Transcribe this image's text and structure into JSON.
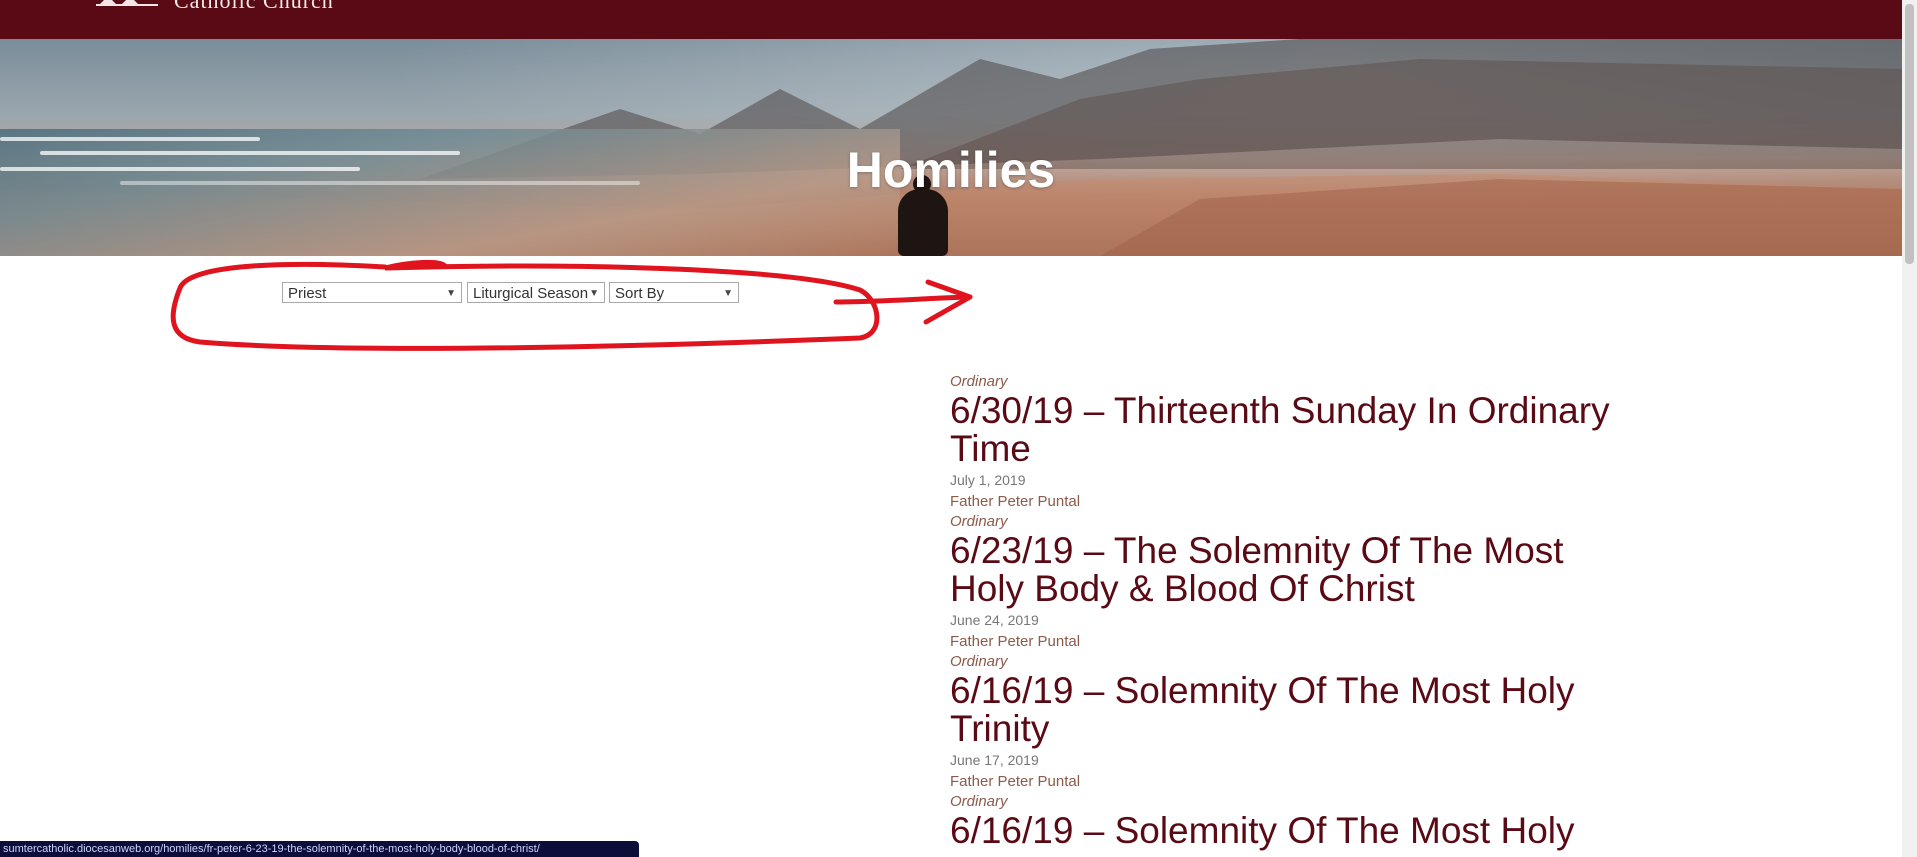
{
  "site": {
    "name_fragment": "Catholic Church"
  },
  "hero": {
    "title": "Homilies"
  },
  "filters": {
    "priest": "Priest",
    "season": "Liturgical Season",
    "sort": "Sort By"
  },
  "homilies": [
    {
      "season": "Ordinary",
      "title": "6/30/19 – Thirteenth Sunday In Ordinary Time",
      "date": "July 1, 2019",
      "priest": "Father Peter Puntal"
    },
    {
      "season": "Ordinary",
      "title": "6/23/19 – The Solemnity Of The Most Holy Body & Blood Of Christ",
      "date": "June 24, 2019",
      "priest": "Father Peter Puntal"
    },
    {
      "season": "Ordinary",
      "title": "6/16/19 – Solemnity Of The Most Holy Trinity",
      "date": "June 17, 2019",
      "priest": "Father Peter Puntal"
    },
    {
      "season": "Ordinary",
      "title": "6/16/19 – Solemnity Of The Most Holy",
      "date": "",
      "priest": ""
    }
  ],
  "status_url": "sumtercatholic.diocesanweb.org/homilies/fr-peter-6-23-19-the-solemnity-of-the-most-holy-body-blood-of-christ/",
  "colors": {
    "brand": "#5a0a14",
    "annotation": "#e0141e"
  }
}
